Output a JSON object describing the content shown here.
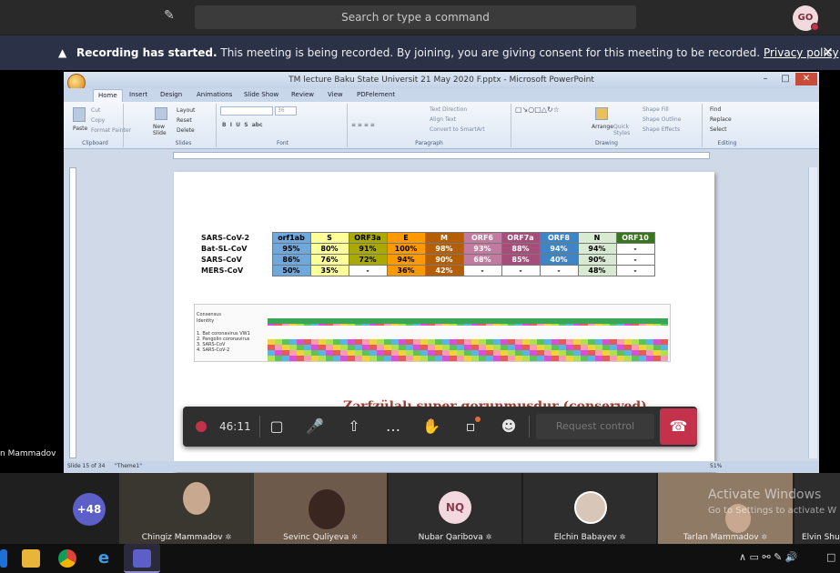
{
  "topbar": {
    "search_placeholder": "Search or type a command",
    "user_initials": "GO"
  },
  "banner": {
    "title": "Recording has started.",
    "message": "This meeting is being recorded. By joining, you are giving consent for this meeting to be recorded.",
    "link": "Privacy policy"
  },
  "ppt": {
    "window_title": "TM lecture Baku State Universit 21 May 2020 F.pptx - Microsoft PowerPoint",
    "tabs": [
      "Home",
      "Insert",
      "Design",
      "Animations",
      "Slide Show",
      "Review",
      "View",
      "PDFelement"
    ],
    "groups": [
      "Clipboard",
      "Slides",
      "Font",
      "Paragraph",
      "Drawing",
      "Editing"
    ],
    "clipboard_items": [
      "Cut",
      "Copy",
      "Format Painter"
    ],
    "paste_label": "Paste",
    "new_slide_label": "New Slide",
    "slides_items": [
      "Layout",
      "Reset",
      "Delete"
    ],
    "font_size": "36",
    "paragraph_items": [
      "Text Direction",
      "Align Text",
      "Convert to SmartArt"
    ],
    "drawing_items": [
      "Shape Fill",
      "Shape Outline",
      "Shape Effects"
    ],
    "arrange_label": "Arrange",
    "quick_styles_label": "Quick Styles",
    "editing_items": [
      "Find",
      "Replace",
      "Select"
    ],
    "status_slide": "Slide 15 of 34",
    "status_theme": "\"Theme1\"",
    "zoom": "51%"
  },
  "slide": {
    "table": {
      "columns": [
        "orf1ab",
        "S",
        "ORF3a",
        "E",
        "M",
        "ORF6",
        "ORF7a",
        "ORF8",
        "N",
        "ORF10"
      ],
      "header_colors": [
        "#6fa8dc",
        "#ffff99",
        "#a9a900",
        "#ff9900",
        "#b45f06",
        "#c27ba0",
        "#a64d79",
        "#3d85c6",
        "#d9ead3",
        "#38761d"
      ],
      "header_text_colors": [
        "#000",
        "#000",
        "#000",
        "#000",
        "#fff",
        "#fff",
        "#fff",
        "#fff",
        "#000",
        "#fff"
      ],
      "rows": [
        {
          "name": "SARS-CoV-2",
          "cells": [
            "",
            "",
            "",
            "",
            "",
            "",
            "",
            "",
            "",
            ""
          ]
        },
        {
          "name": "Bat-SL-CoV",
          "cells": [
            "95%",
            "80%",
            "91%",
            "100%",
            "98%",
            "93%",
            "88%",
            "94%",
            "94%",
            "-"
          ]
        },
        {
          "name": "SARS-CoV",
          "cells": [
            "86%",
            "76%",
            "72%",
            "94%",
            "90%",
            "68%",
            "85%",
            "40%",
            "90%",
            "-"
          ]
        },
        {
          "name": "MERS-CoV",
          "cells": [
            "50%",
            "35%",
            "-",
            "36%",
            "42%",
            "-",
            "-",
            "-",
            "48%",
            "-"
          ]
        }
      ]
    },
    "alignment_labels": [
      "Consensus",
      "Identity",
      "1. Bat coronavirus VW1",
      "2. Pangolin coronavirus",
      "3. SARS-CoV",
      "4. SARS-CoV-2"
    ],
    "caption": "Zərfzülalı super qorunmuşdur (conserved)"
  },
  "controls": {
    "timer": "46:11",
    "request_control": "Request control"
  },
  "presenter_partial_name": "n Mammadov",
  "participants": {
    "overflow": "+48",
    "tiles": [
      {
        "name": "Chingiz Mammadov"
      },
      {
        "name": "Sevinc Quliyeva"
      },
      {
        "name": "Nubar Qaribova",
        "initials": "NQ"
      },
      {
        "name": "Elchin Babayev"
      },
      {
        "name": "Tarlan Mammadov"
      },
      {
        "name": "Elvin Shu"
      }
    ]
  },
  "watermark": {
    "line1": "Activate Windows",
    "line2": "Go to Settings to activate W"
  }
}
